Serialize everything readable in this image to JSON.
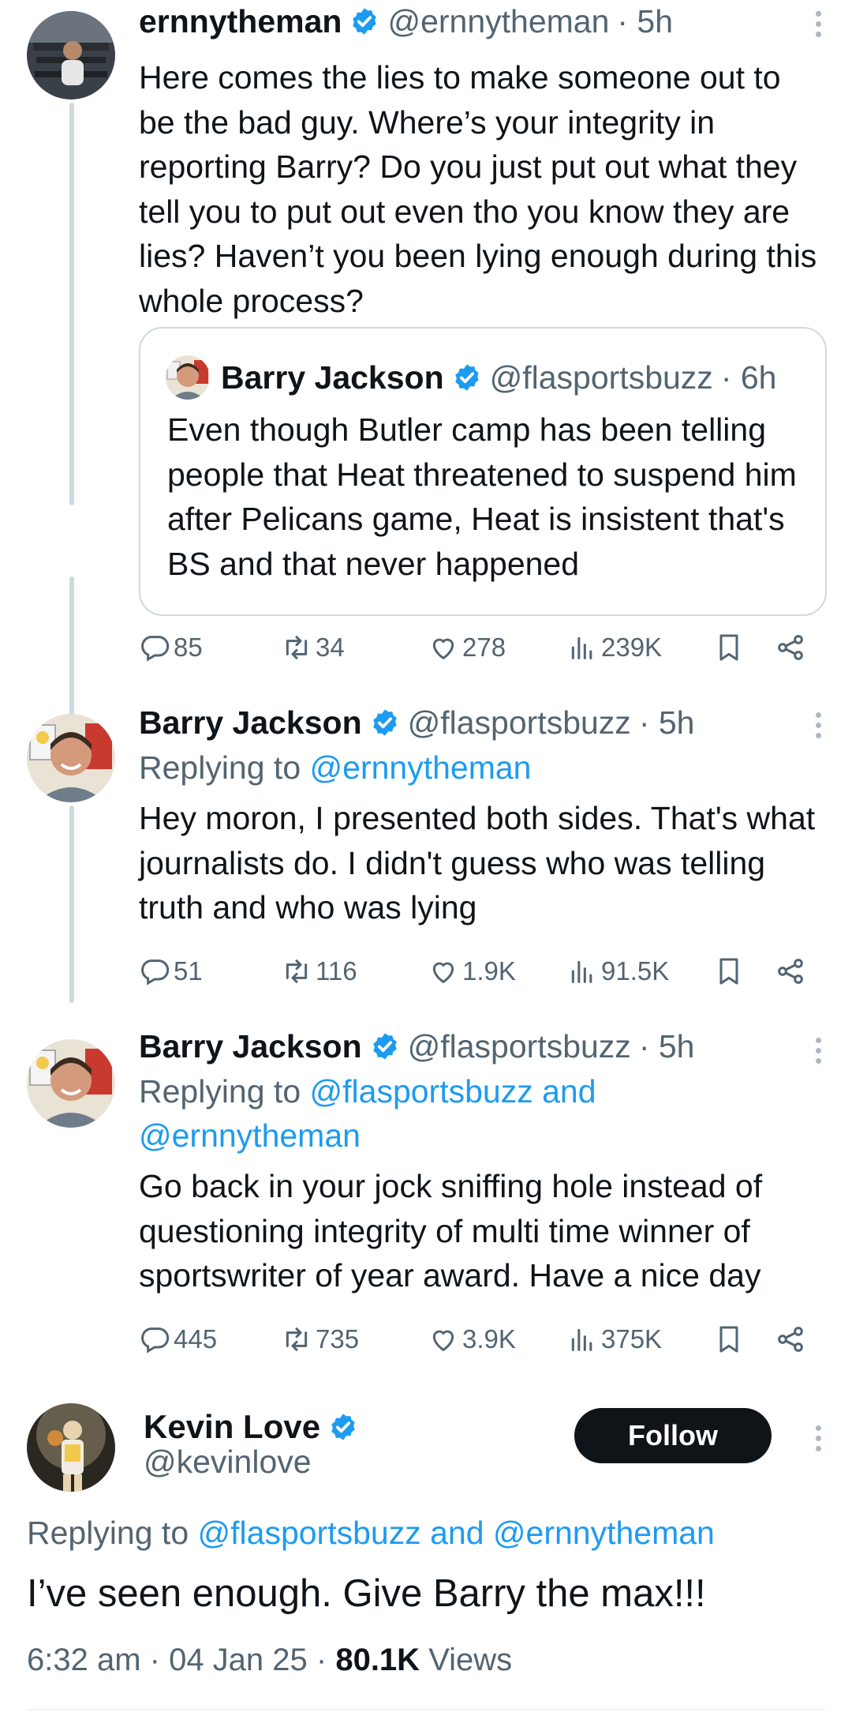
{
  "tweets": [
    {
      "name": "ernnytheman",
      "handle": "@ernnytheman",
      "time": "· 5h",
      "text": "Here comes the lies to make someone out to be the bad guy. Where’s your integrity in reporting Barry? Do you just put out what they tell you to put out even tho you know they are lies? Haven’t you been lying enough during this whole process?",
      "quote": {
        "name": "Barry Jackson",
        "handle": "@flasportsbuzz",
        "time": "· 6h",
        "text": "Even though Butler camp has been telling people that Heat threatened to suspend him after Pelicans game, Heat is insistent that's BS and that never happened"
      },
      "stats": {
        "replies": "85",
        "reposts": "34",
        "likes": "278",
        "views": "239K"
      }
    },
    {
      "name": "Barry Jackson",
      "handle": "@flasportsbuzz",
      "time": "· 5h",
      "replying_prefix": "Replying to",
      "replying_to": "@ernnytheman",
      "text": "Hey moron, I presented both sides. That's what journalists do. I didn't guess who was telling truth and who was lying",
      "stats": {
        "replies": "51",
        "reposts": "116",
        "likes": "1.9K",
        "views": "91.5K"
      }
    },
    {
      "name": "Barry Jackson",
      "handle": "@flasportsbuzz",
      "time": "· 5h",
      "replying_prefix": "Replying to",
      "replying_to": "@flasportsbuzz and @ernnytheman",
      "text": "Go back in your jock sniffing hole instead of questioning integrity of multi time winner of sportswriter of year award. Have a nice day",
      "stats": {
        "replies": "445",
        "reposts": "735",
        "likes": "3.9K",
        "views": "375K"
      }
    }
  ],
  "main_tweet": {
    "name": "Kevin Love",
    "handle": "@kevinlove",
    "follow_label": "Follow",
    "replying_prefix": "Replying to",
    "replying_to": "@flasportsbuzz and @ernnytheman",
    "text": "I’ve seen enough. Give Barry the max!!!",
    "time": "6:32 am",
    "date": "04 Jan 25",
    "views_count": "80.1K",
    "views_label": "Views"
  },
  "colors": {
    "accent": "#1d9bf0",
    "text": "#0f1419",
    "muted": "#536471",
    "border": "#cfd9de",
    "follow_bg": "#0f1419"
  },
  "icons": {
    "verified": "verified-badge-icon",
    "reply": "reply-icon",
    "repost": "repost-icon",
    "like": "like-icon",
    "views": "views-icon",
    "bookmark": "bookmark-icon",
    "share": "share-icon",
    "more": "more-icon"
  }
}
